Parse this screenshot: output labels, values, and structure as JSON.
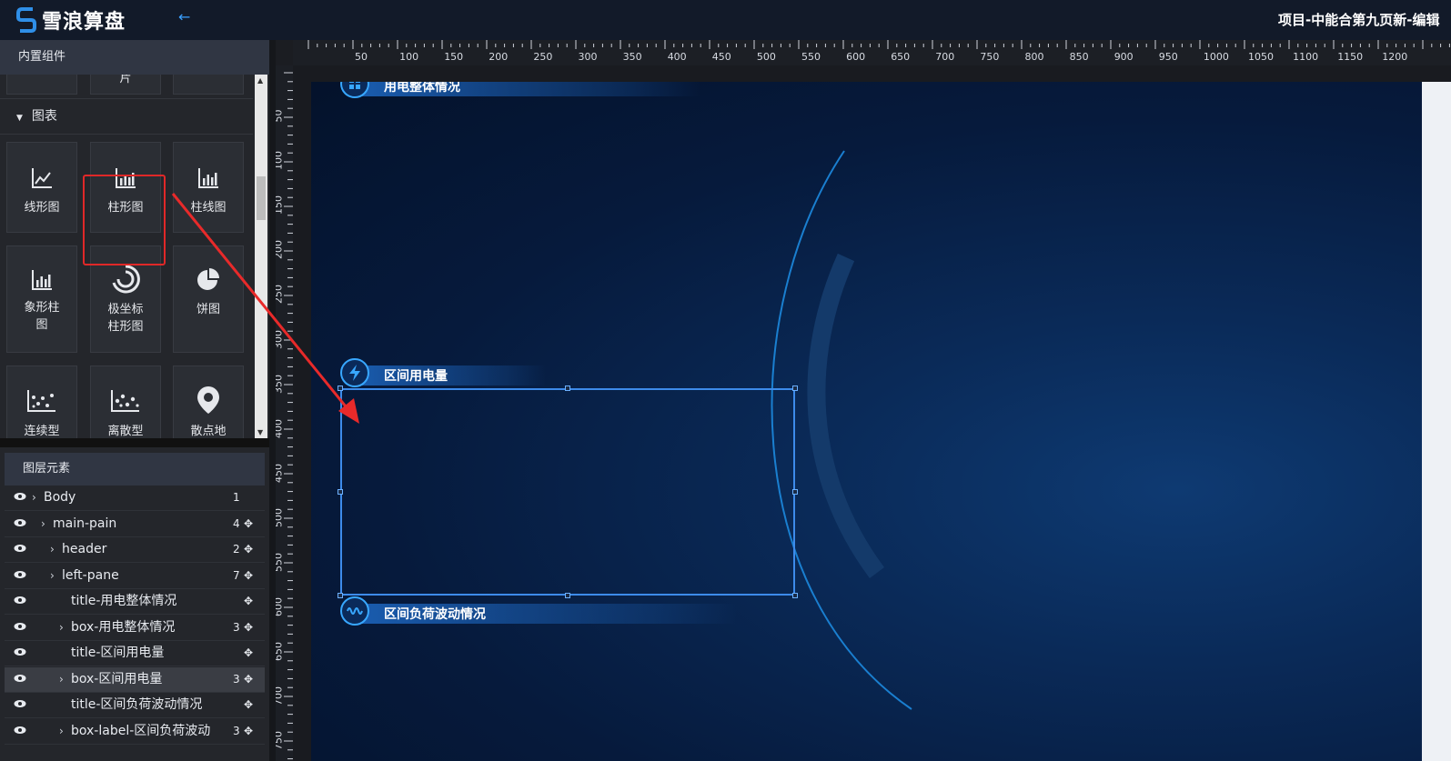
{
  "app": {
    "brand": "雪浪算盘",
    "project_title": "项目-中能合第九页新-编辑"
  },
  "colors": {
    "accent": "#3aa0ff",
    "highlight": "#e02828",
    "selection": "#3d8bea",
    "canvas": "#061a3c"
  },
  "left_panel": {
    "title": "内置组件",
    "top_partial_label": "片",
    "category": "图表",
    "components": [
      {
        "label": "线形图",
        "icon": "line-chart-icon"
      },
      {
        "label": "柱形图",
        "icon": "bar-chart-icon",
        "highlighted": true
      },
      {
        "label": "柱线图",
        "icon": "bar-line-chart-icon"
      },
      {
        "label": "象形柱图",
        "icon": "pictorial-bar-icon"
      },
      {
        "label": "极坐标柱形图",
        "icon": "polar-bar-icon"
      },
      {
        "label": "饼图",
        "icon": "pie-chart-icon"
      },
      {
        "label": "连续型",
        "icon": "continuous-scatter-icon"
      },
      {
        "label": "离散型",
        "icon": "discrete-scatter-icon"
      },
      {
        "label": "散点地",
        "icon": "map-pin-icon"
      }
    ]
  },
  "layers": {
    "title": "图层元素",
    "items": [
      {
        "name": "Body",
        "count": "1",
        "movable": false,
        "expandable": true,
        "selected": false
      },
      {
        "name": "main-pain",
        "count": "4",
        "movable": true,
        "expandable": true,
        "selected": false
      },
      {
        "name": "header",
        "count": "2",
        "movable": true,
        "expandable": true,
        "selected": false
      },
      {
        "name": "left-pane",
        "count": "7",
        "movable": true,
        "expandable": true,
        "selected": false
      },
      {
        "name": "title-用电整体情况",
        "count": "",
        "movable": true,
        "expandable": false,
        "selected": false
      },
      {
        "name": "box-用电整体情况",
        "count": "3",
        "movable": true,
        "expandable": true,
        "selected": false
      },
      {
        "name": "title-区间用电量",
        "count": "",
        "movable": true,
        "expandable": false,
        "selected": false
      },
      {
        "name": "box-区间用电量",
        "count": "3",
        "movable": true,
        "expandable": true,
        "selected": true
      },
      {
        "name": "title-区间负荷波动情况",
        "count": "",
        "movable": true,
        "expandable": false,
        "selected": false
      },
      {
        "name": "box-label-区间负荷波动",
        "count": "3",
        "movable": true,
        "expandable": true,
        "selected": false
      }
    ]
  },
  "ruler": {
    "h_labels": [
      "50",
      "100",
      "150",
      "200",
      "250",
      "300",
      "350",
      "400",
      "450",
      "500",
      "550",
      "600",
      "650",
      "700",
      "750",
      "800",
      "850",
      "900",
      "950",
      "1000",
      "1050",
      "1100",
      "1150",
      "1200"
    ],
    "v_labels": [
      "50",
      "100",
      "150",
      "200",
      "250",
      "300",
      "350",
      "400",
      "450",
      "500",
      "550",
      "600",
      "650",
      "700",
      "750"
    ]
  },
  "canvas": {
    "titles": [
      {
        "text": "用电整体情况",
        "icon": "grid-icon"
      },
      {
        "text": "区间用电量",
        "icon": "lightning-icon"
      },
      {
        "text": "区间负荷波动情况",
        "icon": "wave-icon"
      }
    ]
  }
}
